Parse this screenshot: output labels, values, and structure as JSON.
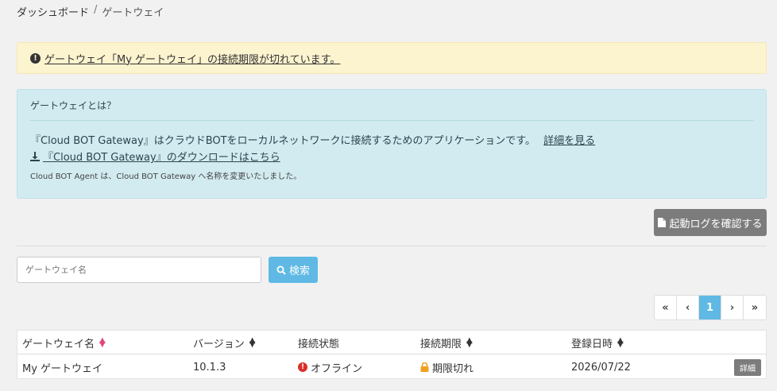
{
  "breadcrumb": {
    "home": "ダッシュボード",
    "separator": "/",
    "current": "ゲートウェイ"
  },
  "warning": {
    "message": "ゲートウェイ「My ゲートウェイ」の接続期限が切れています。"
  },
  "info": {
    "title": "ゲートウェイとは？",
    "line1": "『Cloud BOT Gateway』はクラウドBOTをローカルネットワークに接続するためのアプリケーションです。",
    "line1_link": "詳細を見る",
    "download_link": "『Cloud BOT Gateway』のダウンロードはこちら",
    "note": "Cloud BOT Agent は、Cloud BOT Gateway へ名称を変更いたしました。"
  },
  "log_button": "起動ログを確認する",
  "search": {
    "placeholder": "ゲートウェイ名",
    "button": "検索"
  },
  "pager": {
    "first": "«",
    "prev": "‹",
    "current": "1",
    "next": "›",
    "last": "»"
  },
  "table": {
    "headers": {
      "name": "ゲートウェイ名",
      "version": "バージョン",
      "status": "接続状態",
      "expiry": "接続期限",
      "registered": "登録日時"
    },
    "rows": [
      {
        "name": "My ゲートウェイ",
        "version": "10.1.3",
        "status": "オフライン",
        "expiry": "期限切れ",
        "registered": "2026/07/22",
        "detail": "詳細"
      }
    ]
  },
  "colors": {
    "accent": "#5fb9e4",
    "warning_bg": "#fcf3cf",
    "info_bg": "#d2ebf0",
    "error": "#d9302b",
    "lock": "#f0a020"
  }
}
